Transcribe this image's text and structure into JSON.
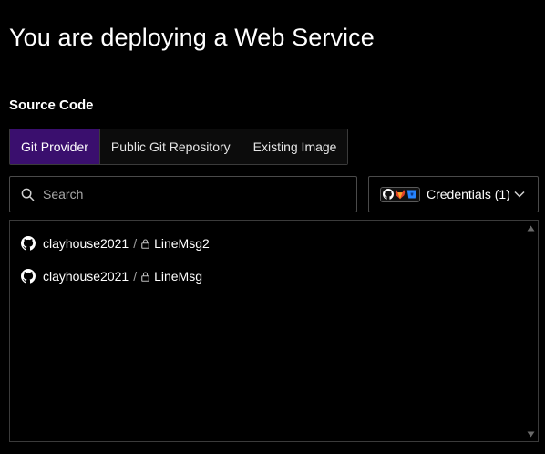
{
  "page": {
    "title": "You are deploying a Web Service",
    "section_label": "Source Code"
  },
  "tabs": [
    {
      "label": "Git Provider",
      "active": true
    },
    {
      "label": "Public Git Repository",
      "active": false
    },
    {
      "label": "Existing Image",
      "active": false
    }
  ],
  "search": {
    "placeholder": "Search",
    "value": ""
  },
  "credentials": {
    "label": "Credentials (1)",
    "provider_icons": [
      "github-icon",
      "gitlab-icon",
      "bitbucket-icon"
    ]
  },
  "repositories": [
    {
      "owner": "clayhouse2021",
      "separator": "/",
      "name": "LineMsg2",
      "icon": "github-icon",
      "private": true
    },
    {
      "owner": "clayhouse2021",
      "separator": "/",
      "name": "LineMsg",
      "icon": "github-icon",
      "private": true
    }
  ],
  "colors": {
    "background": "#000000",
    "active_tab": "#3a0f6e",
    "border": "#3b3b3b",
    "text": "#ffffff",
    "muted_text": "#a8a8a8"
  }
}
